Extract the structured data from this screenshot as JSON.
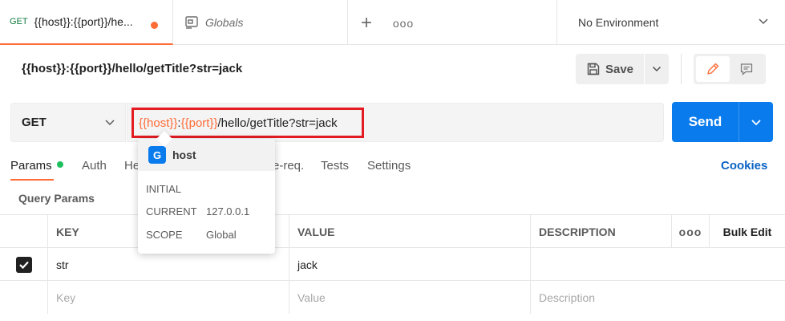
{
  "tabs": {
    "request_tab": {
      "method": "GET",
      "name": "{{host}}:{{port}}/he..."
    },
    "globals_tab": {
      "label": "Globals"
    },
    "new_tab_symbol": "+",
    "more_symbol": "ooo"
  },
  "environment": {
    "selected": "No Environment"
  },
  "request": {
    "title": "{{host}}:{{port}}/hello/getTitle?str=jack",
    "save_label": "Save"
  },
  "url_bar": {
    "method": "GET",
    "url_parts": {
      "var_host": "{{host}}",
      "colon": ":",
      "var_port": "{{port}}",
      "path": "/hello/getTitle?str=jack"
    },
    "send_label": "Send"
  },
  "request_tabs": {
    "params": "Params",
    "auth": "Auth",
    "headers_partial": "He",
    "prereq_partial": "e-req.",
    "tests": "Tests",
    "settings": "Settings",
    "cookies": "Cookies"
  },
  "query_params": {
    "title": "Query Params",
    "headers": {
      "key": "KEY",
      "value": "VALUE",
      "description": "DESCRIPTION",
      "more": "ooo",
      "bulk_edit": "Bulk Edit"
    },
    "rows": [
      {
        "checked": true,
        "key": "str",
        "value": "jack",
        "description": ""
      }
    ],
    "placeholder": {
      "key": "Key",
      "value": "Value",
      "description": "Description"
    }
  },
  "variable_tooltip": {
    "scope_badge": "G",
    "name": "host",
    "initial_label": "INITIAL",
    "initial_value": "",
    "current_label": "CURRENT",
    "current_value": "127.0.0.1",
    "scope_label": "SCOPE",
    "scope_value": "Global"
  },
  "colors": {
    "accent": "#ff6c37",
    "send_blue": "#097bed",
    "highlight_red": "#e31b23",
    "link_blue": "#0b63c4",
    "active_dot_green": "#1fbe5e"
  }
}
